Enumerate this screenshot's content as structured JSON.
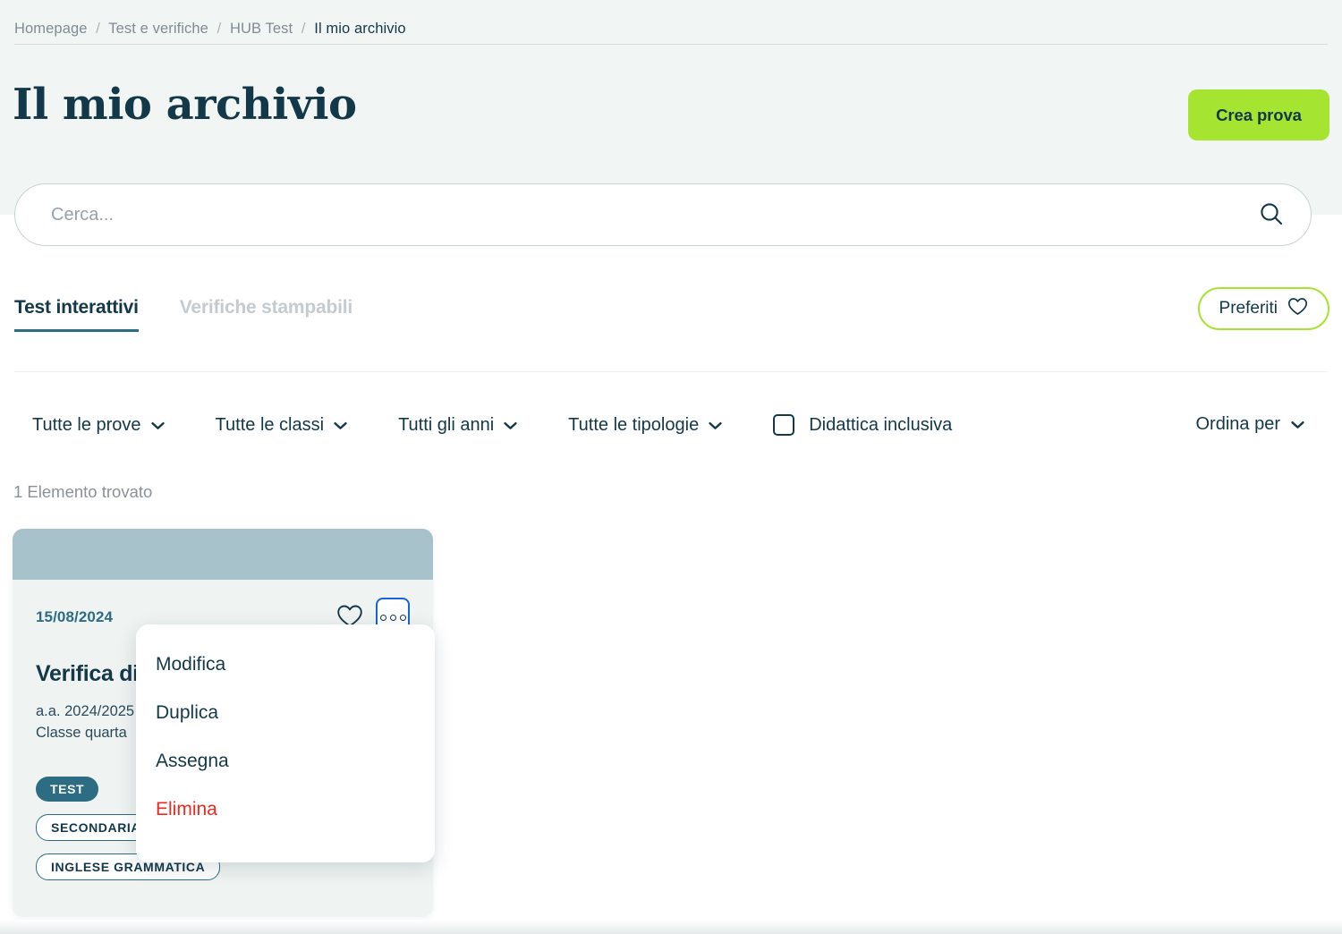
{
  "breadcrumb": {
    "items": [
      {
        "label": "Homepage",
        "current": false
      },
      {
        "label": "Test e verifiche",
        "current": false
      },
      {
        "label": "HUB Test",
        "current": false
      },
      {
        "label": "Il mio archivio",
        "current": true
      }
    ],
    "separator": "/"
  },
  "header": {
    "title": "Il mio archivio",
    "create_button": "Crea prova"
  },
  "search": {
    "placeholder": "Cerca...",
    "value": "",
    "icon": "search-icon"
  },
  "tabs": [
    {
      "label": "Test interattivi",
      "active": true
    },
    {
      "label": "Verifiche stampabili",
      "active": false
    }
  ],
  "favorites_button": {
    "label": "Preferiti",
    "icon": "heart-icon"
  },
  "filters": [
    {
      "label": "Tutte le prove",
      "icon": "chevron-down-icon"
    },
    {
      "label": "Tutte le classi",
      "icon": "chevron-down-icon"
    },
    {
      "label": "Tutti gli anni",
      "icon": "chevron-down-icon"
    },
    {
      "label": "Tutte le tipologie",
      "icon": "chevron-down-icon"
    }
  ],
  "inclusive_checkbox": {
    "label": "Didattica inclusiva",
    "checked": false
  },
  "sort": {
    "label": "Ordina per",
    "icon": "chevron-down-icon"
  },
  "results": {
    "count_text": "1 Elemento trovato"
  },
  "card": {
    "date": "15/08/2024",
    "title": "Verifica di",
    "academic_year": "a.a. 2024/2025",
    "class": "Classe quarta",
    "tags": [
      {
        "label": "TEST",
        "style": "solid"
      },
      {
        "label": "SECONDARIA",
        "style": "outline"
      },
      {
        "label": "INGLESE GRAMMATICA",
        "style": "outline"
      }
    ],
    "favorite_icon": "heart-icon",
    "more_icon": "three-dots-icon"
  },
  "context_menu": {
    "items": [
      {
        "label": "Modifica",
        "danger": false
      },
      {
        "label": "Duplica",
        "danger": false
      },
      {
        "label": "Assegna",
        "danger": false
      },
      {
        "label": "Elimina",
        "danger": true
      }
    ]
  },
  "colors": {
    "accent_green": "#a6e432",
    "teal": "#2d6d84",
    "navy": "#123849",
    "danger_red": "#f0281e",
    "focus_blue": "#1565d8",
    "banner": "#a8c2cc",
    "band_bg": "#f1f5f3"
  }
}
